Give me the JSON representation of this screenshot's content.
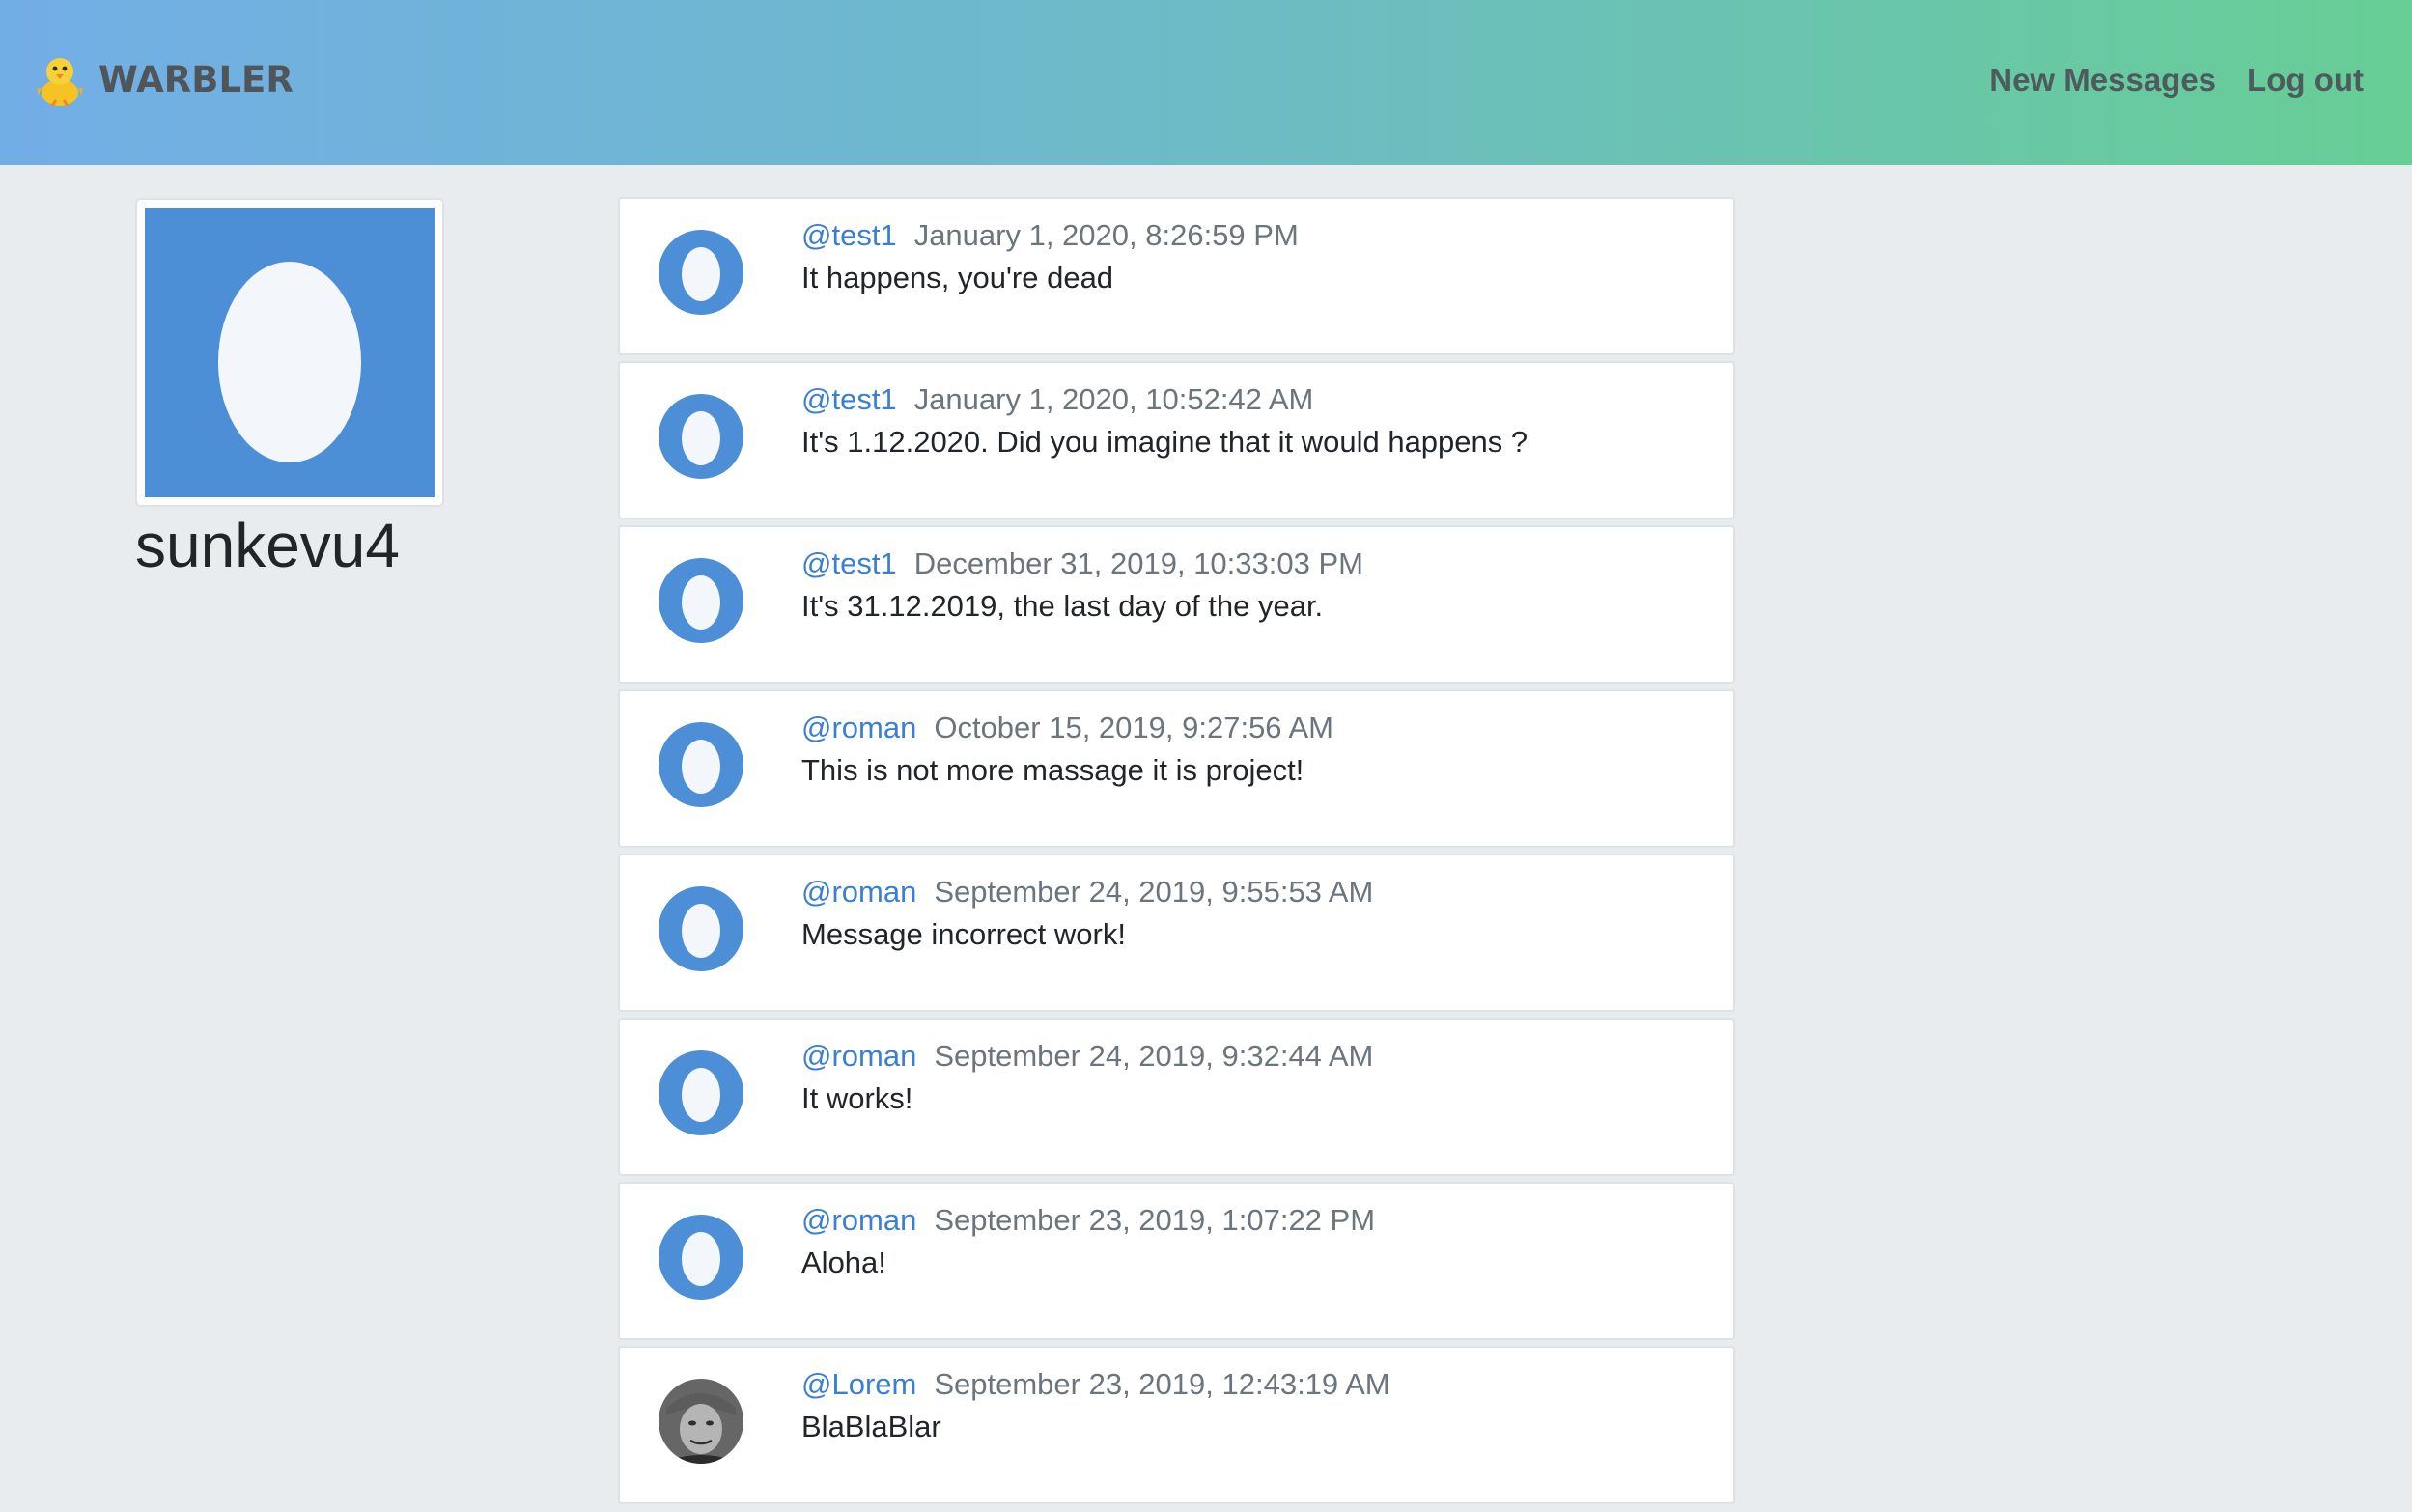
{
  "navbar": {
    "brand": "WARBLER",
    "links": [
      "New Messages",
      "Log out"
    ]
  },
  "colors": {
    "accent": "#3b7fd3",
    "egg_blue": "#4d8fd6",
    "gradient_start": "#72aee6",
    "gradient_end": "#67ce95"
  },
  "profile": {
    "username": "sunkevu4",
    "avatar_icon": "egg-avatar-icon"
  },
  "messages": [
    {
      "handle": "@test1",
      "timestamp": "January 1, 2020, 8:26:59 PM",
      "text": "It happens, you're dead",
      "avatar": "egg-avatar-icon"
    },
    {
      "handle": "@test1",
      "timestamp": "January 1, 2020, 10:52:42 AM",
      "text": "It's 1.12.2020. Did you imagine that it would happens ?",
      "avatar": "egg-avatar-icon"
    },
    {
      "handle": "@test1",
      "timestamp": "December 31, 2019, 10:33:03 PM",
      "text": "It's 31.12.2019, the last day of the year.",
      "avatar": "egg-avatar-icon"
    },
    {
      "handle": "@roman",
      "timestamp": "October 15, 2019, 9:27:56 AM",
      "text": "This is not more massage it is project!",
      "avatar": "egg-avatar-icon"
    },
    {
      "handle": "@roman",
      "timestamp": "September 24, 2019, 9:55:53 AM",
      "text": "Message incorrect work!",
      "avatar": "egg-avatar-icon"
    },
    {
      "handle": "@roman",
      "timestamp": "September 24, 2019, 9:32:44 AM",
      "text": "It works!",
      "avatar": "egg-avatar-icon"
    },
    {
      "handle": "@roman",
      "timestamp": "September 23, 2019, 1:07:22 PM",
      "text": "Aloha!",
      "avatar": "egg-avatar-icon"
    },
    {
      "handle": "@Lorem",
      "timestamp": "September 23, 2019, 12:43:19 AM",
      "text": "BlaBlaBlar",
      "avatar": "user-photo-avatar"
    }
  ]
}
